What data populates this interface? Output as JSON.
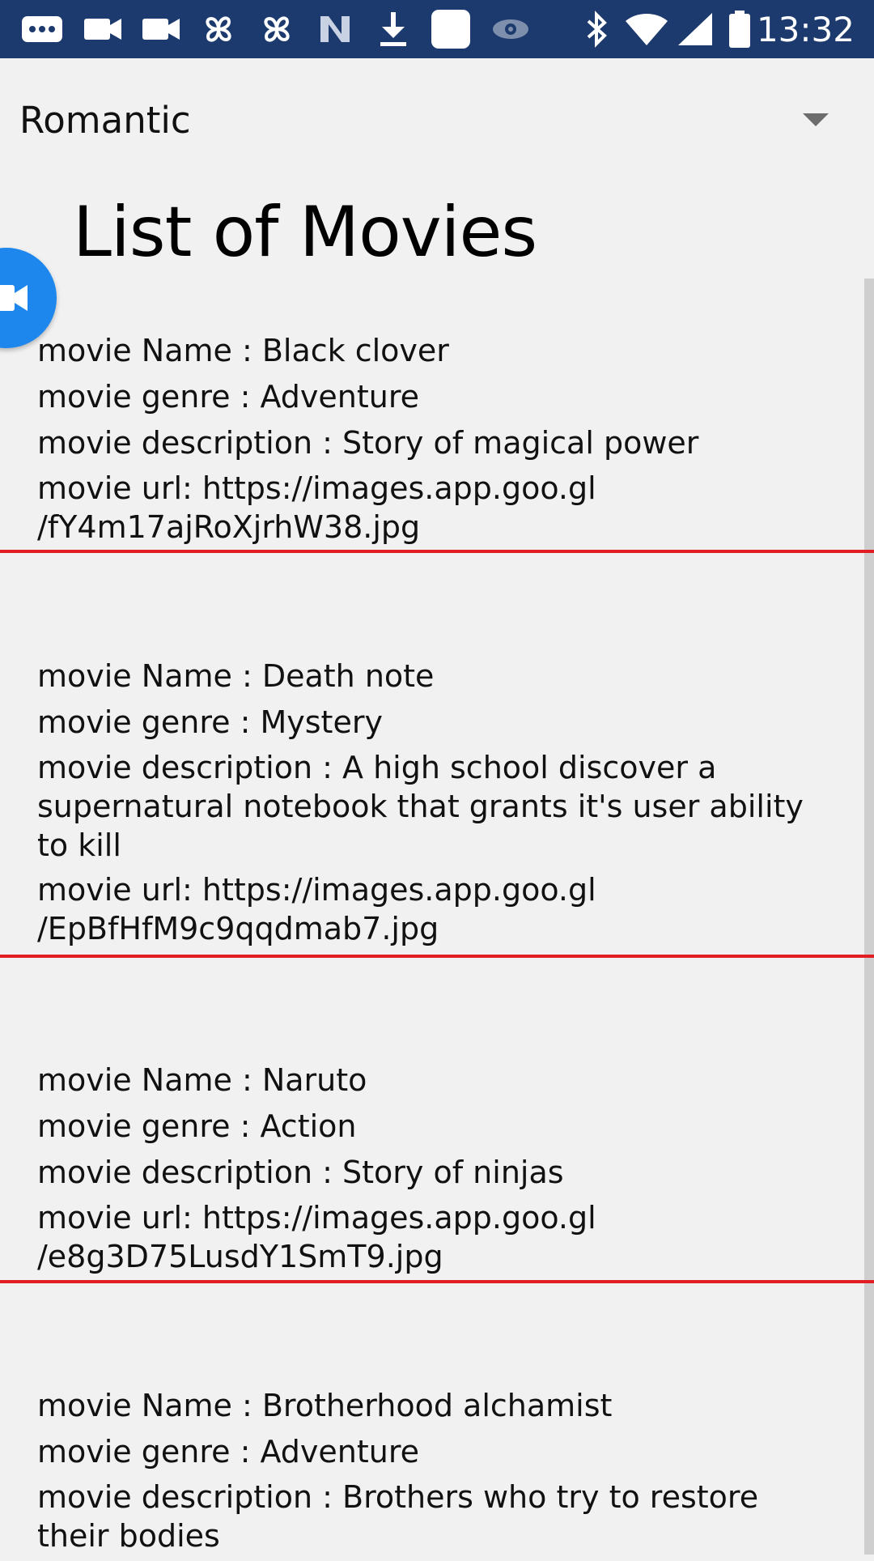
{
  "status_bar": {
    "time": "13:32",
    "icons": [
      "message-icon",
      "video-camera-icon",
      "video-camera-icon",
      "pinwheel-icon",
      "pinwheel-icon",
      "n-logo-icon",
      "download-icon",
      "square-icon",
      "eye-icon",
      "bluetooth-icon",
      "wifi-icon",
      "signal-icon",
      "battery-icon"
    ]
  },
  "spinner": {
    "selected": "Romantic"
  },
  "heading": "List of Movies",
  "movies": [
    {
      "name": "movie Name : Black clover",
      "genre": "movie genre : Adventure",
      "description": "movie description : Story of magical power",
      "url": "movie url: https://images.app.goo.gl\n/fY4m17ajRoXjrhW38.jpg"
    },
    {
      "name": "movie Name : Death note",
      "genre": "movie genre : Mystery",
      "description": "movie description : A high school discover a supernatural notebook that grants it's user ability to kill",
      "url": "movie url: https://images.app.goo.gl\n/EpBfHfM9c9qqdmab7.jpg"
    },
    {
      "name": "movie Name : Naruto",
      "genre": "movie genre : Action",
      "description": "movie description : Story of ninjas",
      "url": "movie url: https://images.app.goo.gl\n/e8g3D75LusdY1SmT9.jpg"
    },
    {
      "name": "movie Name : Brotherhood alchamist",
      "genre": "movie genre : Adventure",
      "description": "movie description : Brothers who try to restore their bodies",
      "url": ""
    }
  ],
  "colors": {
    "status_bar": "#1c3a6e",
    "background": "#f1f1f1",
    "divider": "#e21d24",
    "fab": "#1e87ee"
  }
}
